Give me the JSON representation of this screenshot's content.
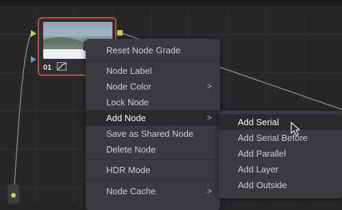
{
  "node": {
    "label": "01"
  },
  "context_menu": {
    "items": [
      {
        "label": "Reset Node Grade"
      },
      {
        "label": "Node Label"
      },
      {
        "label": "Node Color",
        "submenu": true
      },
      {
        "label": "Lock Node"
      },
      {
        "label": "Add Node",
        "submenu": true
      },
      {
        "label": "Save as Shared Node"
      },
      {
        "label": "Delete Node"
      },
      {
        "label": "HDR Mode"
      },
      {
        "label": "Node Cache",
        "submenu": true
      }
    ],
    "arrow_glyph": ">"
  },
  "add_node_submenu": {
    "items": [
      {
        "label": "Add Serial"
      },
      {
        "label": "Add Serial Before"
      },
      {
        "label": "Add Parallel"
      },
      {
        "label": "Add Layer"
      },
      {
        "label": "Add Outside"
      }
    ]
  },
  "colors": {
    "node_border": "#c84a3a",
    "menu_bg": "#3b3b3f",
    "highlight_bg": "#2a2a2d",
    "port_green": "#b9d64a",
    "port_blue": "#4fa3d9"
  }
}
